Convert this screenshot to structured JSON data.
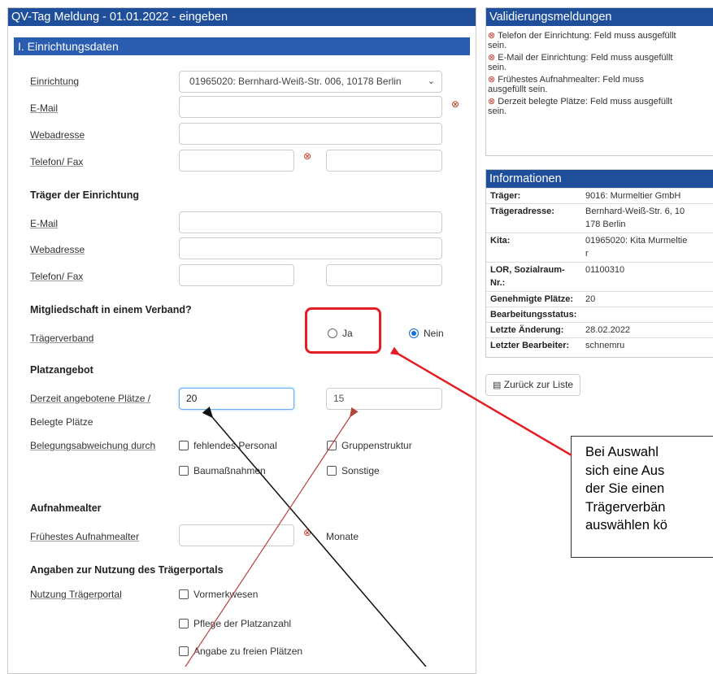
{
  "left_panel": {
    "title": "QV-Tag Meldung - 01.01.2022 - eingeben",
    "section_title": "I. Einrichtungsdaten",
    "einrichtung": {
      "label": "Einrichtung",
      "selected": "01965020: Bernhard-Weiß-Str. 006, 10178 Berlin",
      "email_label": "E-Mail",
      "web_label": "Webadresse",
      "phone_label": "Telefon/ Fax"
    },
    "traeger": {
      "heading": "Träger der Einrichtung",
      "email_label": "E-Mail",
      "web_label": "Webadresse",
      "phone_label": "Telefon/ Fax"
    },
    "verband": {
      "heading": "Mitgliedschaft in einem Verband?",
      "label": "Trägerverband",
      "option_ja": "Ja",
      "option_nein": "Nein",
      "selected": "Nein"
    },
    "platzangebot": {
      "heading": "Platzangebot",
      "label_line1": "Derzeit angebotene Plätze /",
      "label_line2": "Belegte Plätze",
      "angebotene": "20",
      "belegte": "15",
      "abweichung_label": "Belegungsabweichung durch",
      "checkbox_personal": "fehlendes Personal",
      "checkbox_gruppen": "Gruppenstruktur",
      "checkbox_bau": "Baumaßnahmen",
      "checkbox_sonstige": "Sonstige"
    },
    "aufnahmealter": {
      "heading": "Aufnahmealter",
      "label": "Frühestes Aufnahmealter",
      "unit": "Monate"
    },
    "portal": {
      "heading": "Angaben zur Nutzung des Trägerportals",
      "label": "Nutzung Trägerportal",
      "checkbox_vormerk": "Vormerkwesen",
      "checkbox_pflege": "Pflege der Platzanzahl",
      "checkbox_freie": "Angabe zu freien Plätzen"
    }
  },
  "validation": {
    "title": "Validierungsmeldungen",
    "messages": [
      {
        "l1": "Telefon der Einrichtung: Feld muss ausgefüllt",
        "l2": "sein."
      },
      {
        "l1": "E-Mail der Einrichtung: Feld muss ausgefüllt",
        "l2": "sein."
      },
      {
        "l1": "Frühestes Aufnahmealter: Feld muss",
        "l2": "ausgefüllt sein."
      },
      {
        "l1": "Derzeit belegte Plätze: Feld muss ausgefüllt",
        "l2": "sein."
      }
    ]
  },
  "info": {
    "title": "Informationen",
    "rows": [
      {
        "k": "Träger:",
        "v1": "9016: Murmeltier GmbH",
        "v2": ""
      },
      {
        "k": "Trägeradresse:",
        "v1": "Bernhard-Weiß-Str. 6, 10",
        "v2": "178 Berlin"
      },
      {
        "k": "Kita:",
        "v1": "01965020: Kita Murmeltie",
        "v2": "r"
      },
      {
        "k": "LOR, Sozialraum-",
        "k2": "Nr.:",
        "v1": "01100310",
        "v2": ""
      },
      {
        "k": "Genehmigte Plätze:",
        "v1": "20",
        "v2": ""
      },
      {
        "k": "Bearbeitungsstatus:",
        "v1": "",
        "v2": ""
      },
      {
        "k": "Letzte Änderung:",
        "v1": "28.02.2022",
        "v2": ""
      },
      {
        "k": "Letzter Bearbeiter:",
        "v1": "schnemru",
        "v2": ""
      }
    ],
    "back_button": "Zurück zur Liste"
  },
  "callout": {
    "lines": [
      "Bei Auswahl",
      "sich eine Aus",
      "der Sie einen",
      "Trägerverbän",
      "auswählen kö"
    ]
  },
  "icons": {
    "error": "error-circle-icon",
    "list": "list-icon",
    "chevron": "chevron-down-icon"
  },
  "colors": {
    "header": "#1f4f9b",
    "section": "#2a5db0",
    "error": "#c0392b",
    "annotation_red": "#e31e24",
    "radio": "#1a6fd6"
  }
}
